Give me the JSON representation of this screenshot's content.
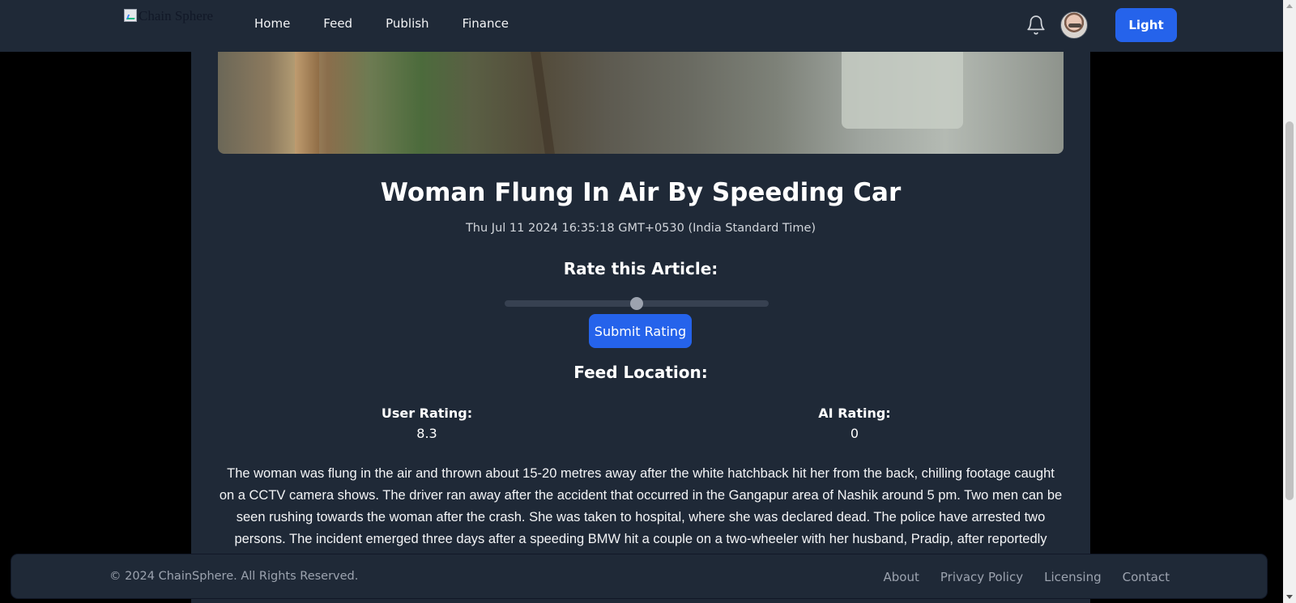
{
  "header": {
    "logo_alt": "Chain Sphere",
    "nav": [
      "Home",
      "Feed",
      "Publish",
      "Finance"
    ],
    "theme_button": "Light"
  },
  "article": {
    "title": "Woman Flung In Air By Speeding Car",
    "date": "Thu Jul 11 2024 16:35:18 GMT+0530 (India Standard Time)",
    "rate_label": "Rate this Article:",
    "slider_value": 0.5,
    "submit_label": "Submit Rating",
    "location_label": "Feed Location:",
    "user_rating_label": "User Rating:",
    "user_rating_value": "8.3",
    "ai_rating_label": "AI Rating:",
    "ai_rating_value": "0",
    "body": "The woman was flung in the air and thrown about 15-20 metres away after the white hatchback hit her from the back, chilling footage caught on a CCTV camera shows. The driver ran away after the accident that occurred in the Gangapur area of Nashik around 5 pm. Two men can be seen rushing towards the woman after the crash. She was taken to hospital, where she was declared dead. The police have arrested two persons. The incident emerged three days after a speeding BMW hit a couple on a two-wheeler with her husband, Pradip, after reportedly shopping for fish. The man behind the wheels was Mihir Shah, the son of politician"
  },
  "footer": {
    "copyright": "© 2024 ChainSphere. All Rights Reserved.",
    "links": [
      "About",
      "Privacy Policy",
      "Licensing",
      "Contact"
    ]
  },
  "colors": {
    "accent": "#2563eb",
    "panel": "#1f2937",
    "background": "#000000"
  },
  "icons": {
    "notifications": "bell-icon"
  }
}
